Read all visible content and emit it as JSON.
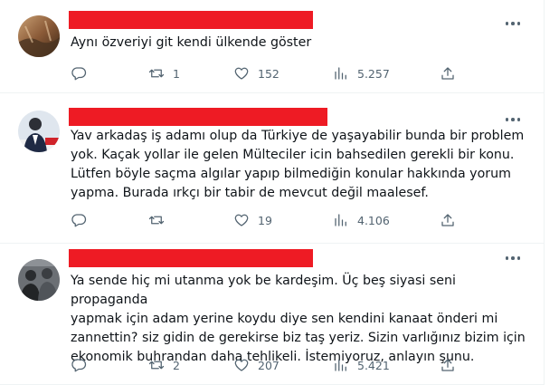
{
  "colors": {
    "redaction": "#ee1b24",
    "icon": "#536471",
    "text": "#0f1419",
    "divider": "#eff3f4"
  },
  "tweets": [
    {
      "text": "Aynı özveriyi git kendi ülkende göster",
      "replies": "",
      "retweets": "1",
      "likes": "152",
      "views": "5.257"
    },
    {
      "text": "Yav arkadaş iş adamı olup da Türkiye de yaşayabilir bunda bir problem\nyok. Kaçak yollar ile gelen Mülteciler icin bahsedilen gerekli bir konu.\nLütfen böyle saçma algılar yapıp bilmediğin konular hakkında yorum\nyapma. Burada ırkçı bir tabir de mevcut değil maalesef.",
      "replies": "",
      "retweets": "",
      "likes": "19",
      "views": "4.106"
    },
    {
      "text": "Ya sende hiç mi utanma yok be kardeşim. Üç beş siyasi seni propaganda\nyapmak için adam yerine koydu diye sen kendini kanaat önderi mi\nzannettin? siz gidin de gerekirse biz taş yeriz. Sizin varlığınız bizim için\nekonomik buhrandan daha tehlikeli. İstemiyoruz, anlayın şunu.",
      "replies": "",
      "retweets": "2",
      "likes": "207",
      "views": "5.421"
    }
  ],
  "icons": {
    "more": "more-dots-icon",
    "reply": "reply-icon",
    "retweet": "retweet-icon",
    "like": "heart-icon",
    "views": "views-chart-icon",
    "share": "share-icon"
  }
}
